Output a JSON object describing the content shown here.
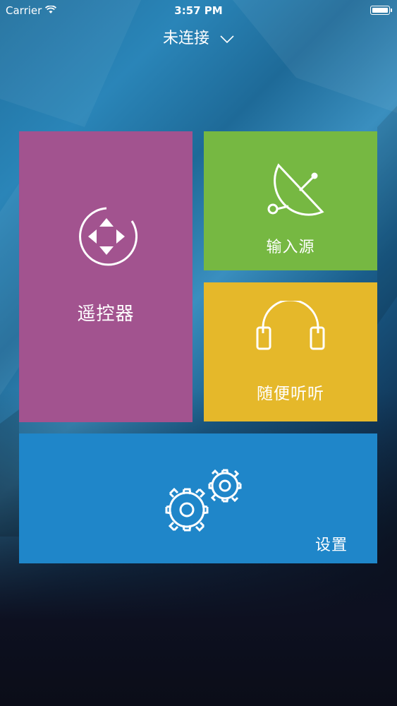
{
  "status_bar": {
    "carrier": "Carrier",
    "time": "3:57 PM",
    "icons": [
      "wifi-icon",
      "battery-icon"
    ]
  },
  "connection": {
    "label": "未连接",
    "dropdown_icon": "chevron-down-icon"
  },
  "tiles": [
    {
      "id": "remote",
      "label": "遥控器",
      "icon": "dpad-icon",
      "color": "#a2538f"
    },
    {
      "id": "source",
      "label": "输入源",
      "icon": "satellite-dish-icon",
      "color": "#76b842"
    },
    {
      "id": "listen",
      "label": "随便听听",
      "icon": "headphones-icon",
      "color": "#e5b82a"
    },
    {
      "id": "settings",
      "label": "设置",
      "icon": "gears-icon",
      "color": "#1f86c9"
    }
  ],
  "colors": {
    "background_top": "#2a85b8",
    "background_bottom": "#0b0d18",
    "text": "#ffffff"
  }
}
